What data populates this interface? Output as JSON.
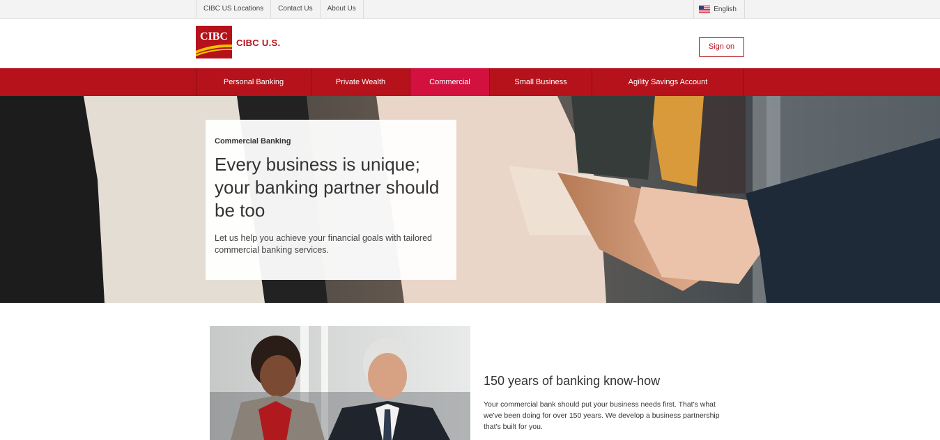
{
  "utility_bar": {
    "links": [
      {
        "label": "CIBC US Locations"
      },
      {
        "label": "Contact Us"
      },
      {
        "label": "About Us"
      }
    ],
    "language": "English"
  },
  "header": {
    "logo_text": "CIBC",
    "brand_name": "CIBC U.S.",
    "signon_label": "Sign on"
  },
  "nav": {
    "items": [
      {
        "label": "Personal Banking"
      },
      {
        "label": "Private Wealth"
      },
      {
        "label": "Commercial"
      },
      {
        "label": "Small Business"
      },
      {
        "label": "Agility Savings Account"
      }
    ],
    "active": "Commercial"
  },
  "hero": {
    "eyebrow": "Commercial Banking",
    "title": "Every business is unique; your banking partner should be too",
    "subtitle": "Let us help you achieve your financial goals with tailored commercial banking services."
  },
  "feature": {
    "title": "150 years of banking know-how",
    "text": "Your commercial bank should put your business needs first. That's what we've been doing for over 150 years. We develop a business partnership that's built for you."
  },
  "colors": {
    "brand_red": "#b5121b",
    "nav_active": "#d2113f",
    "logo_gold": "#f2c200"
  }
}
